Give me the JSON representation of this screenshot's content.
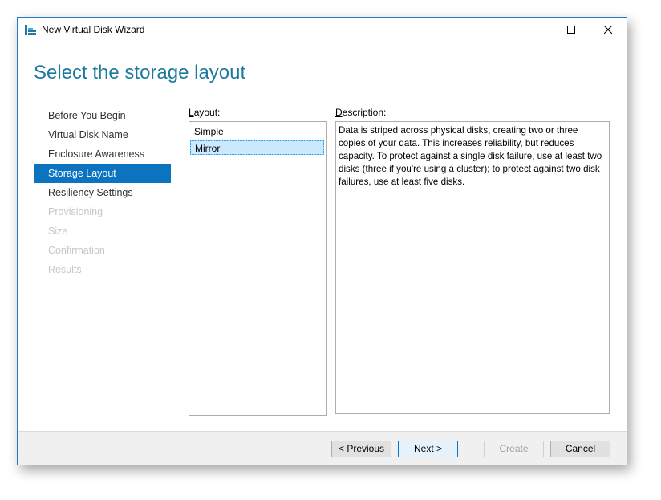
{
  "window": {
    "title": "New Virtual Disk Wizard",
    "accent_color": "#0b73bf",
    "controls": {
      "minimize": "—",
      "maximize": "☐",
      "close": "✕"
    }
  },
  "page": {
    "heading": "Select the storage layout"
  },
  "nav": {
    "items": [
      {
        "label": "Before You Begin",
        "state": "normal"
      },
      {
        "label": "Virtual Disk Name",
        "state": "normal"
      },
      {
        "label": "Enclosure Awareness",
        "state": "normal"
      },
      {
        "label": "Storage Layout",
        "state": "active"
      },
      {
        "label": "Resiliency Settings",
        "state": "normal"
      },
      {
        "label": "Provisioning",
        "state": "disabled"
      },
      {
        "label": "Size",
        "state": "disabled"
      },
      {
        "label": "Confirmation",
        "state": "disabled"
      },
      {
        "label": "Results",
        "state": "disabled"
      }
    ]
  },
  "layout": {
    "label_first": "L",
    "label_rest": "ayout:",
    "options": [
      "Simple",
      "Mirror"
    ],
    "selected": "Mirror"
  },
  "description": {
    "label_first": "D",
    "label_rest": "escription:",
    "text": "Data is striped across physical disks, creating two or three copies of your data. This increases reliability, but reduces capacity. To protect against a single disk failure, use at least two disks (three if you're using a cluster); to protect against two disk failures, use at least five disks."
  },
  "footer": {
    "previous": {
      "pre": "< ",
      "accel": "P",
      "rest": "revious"
    },
    "next": {
      "pre": "",
      "accel": "N",
      "rest": "ext >"
    },
    "create": {
      "pre": "",
      "accel": "C",
      "rest": "reate"
    },
    "cancel": "Cancel"
  }
}
